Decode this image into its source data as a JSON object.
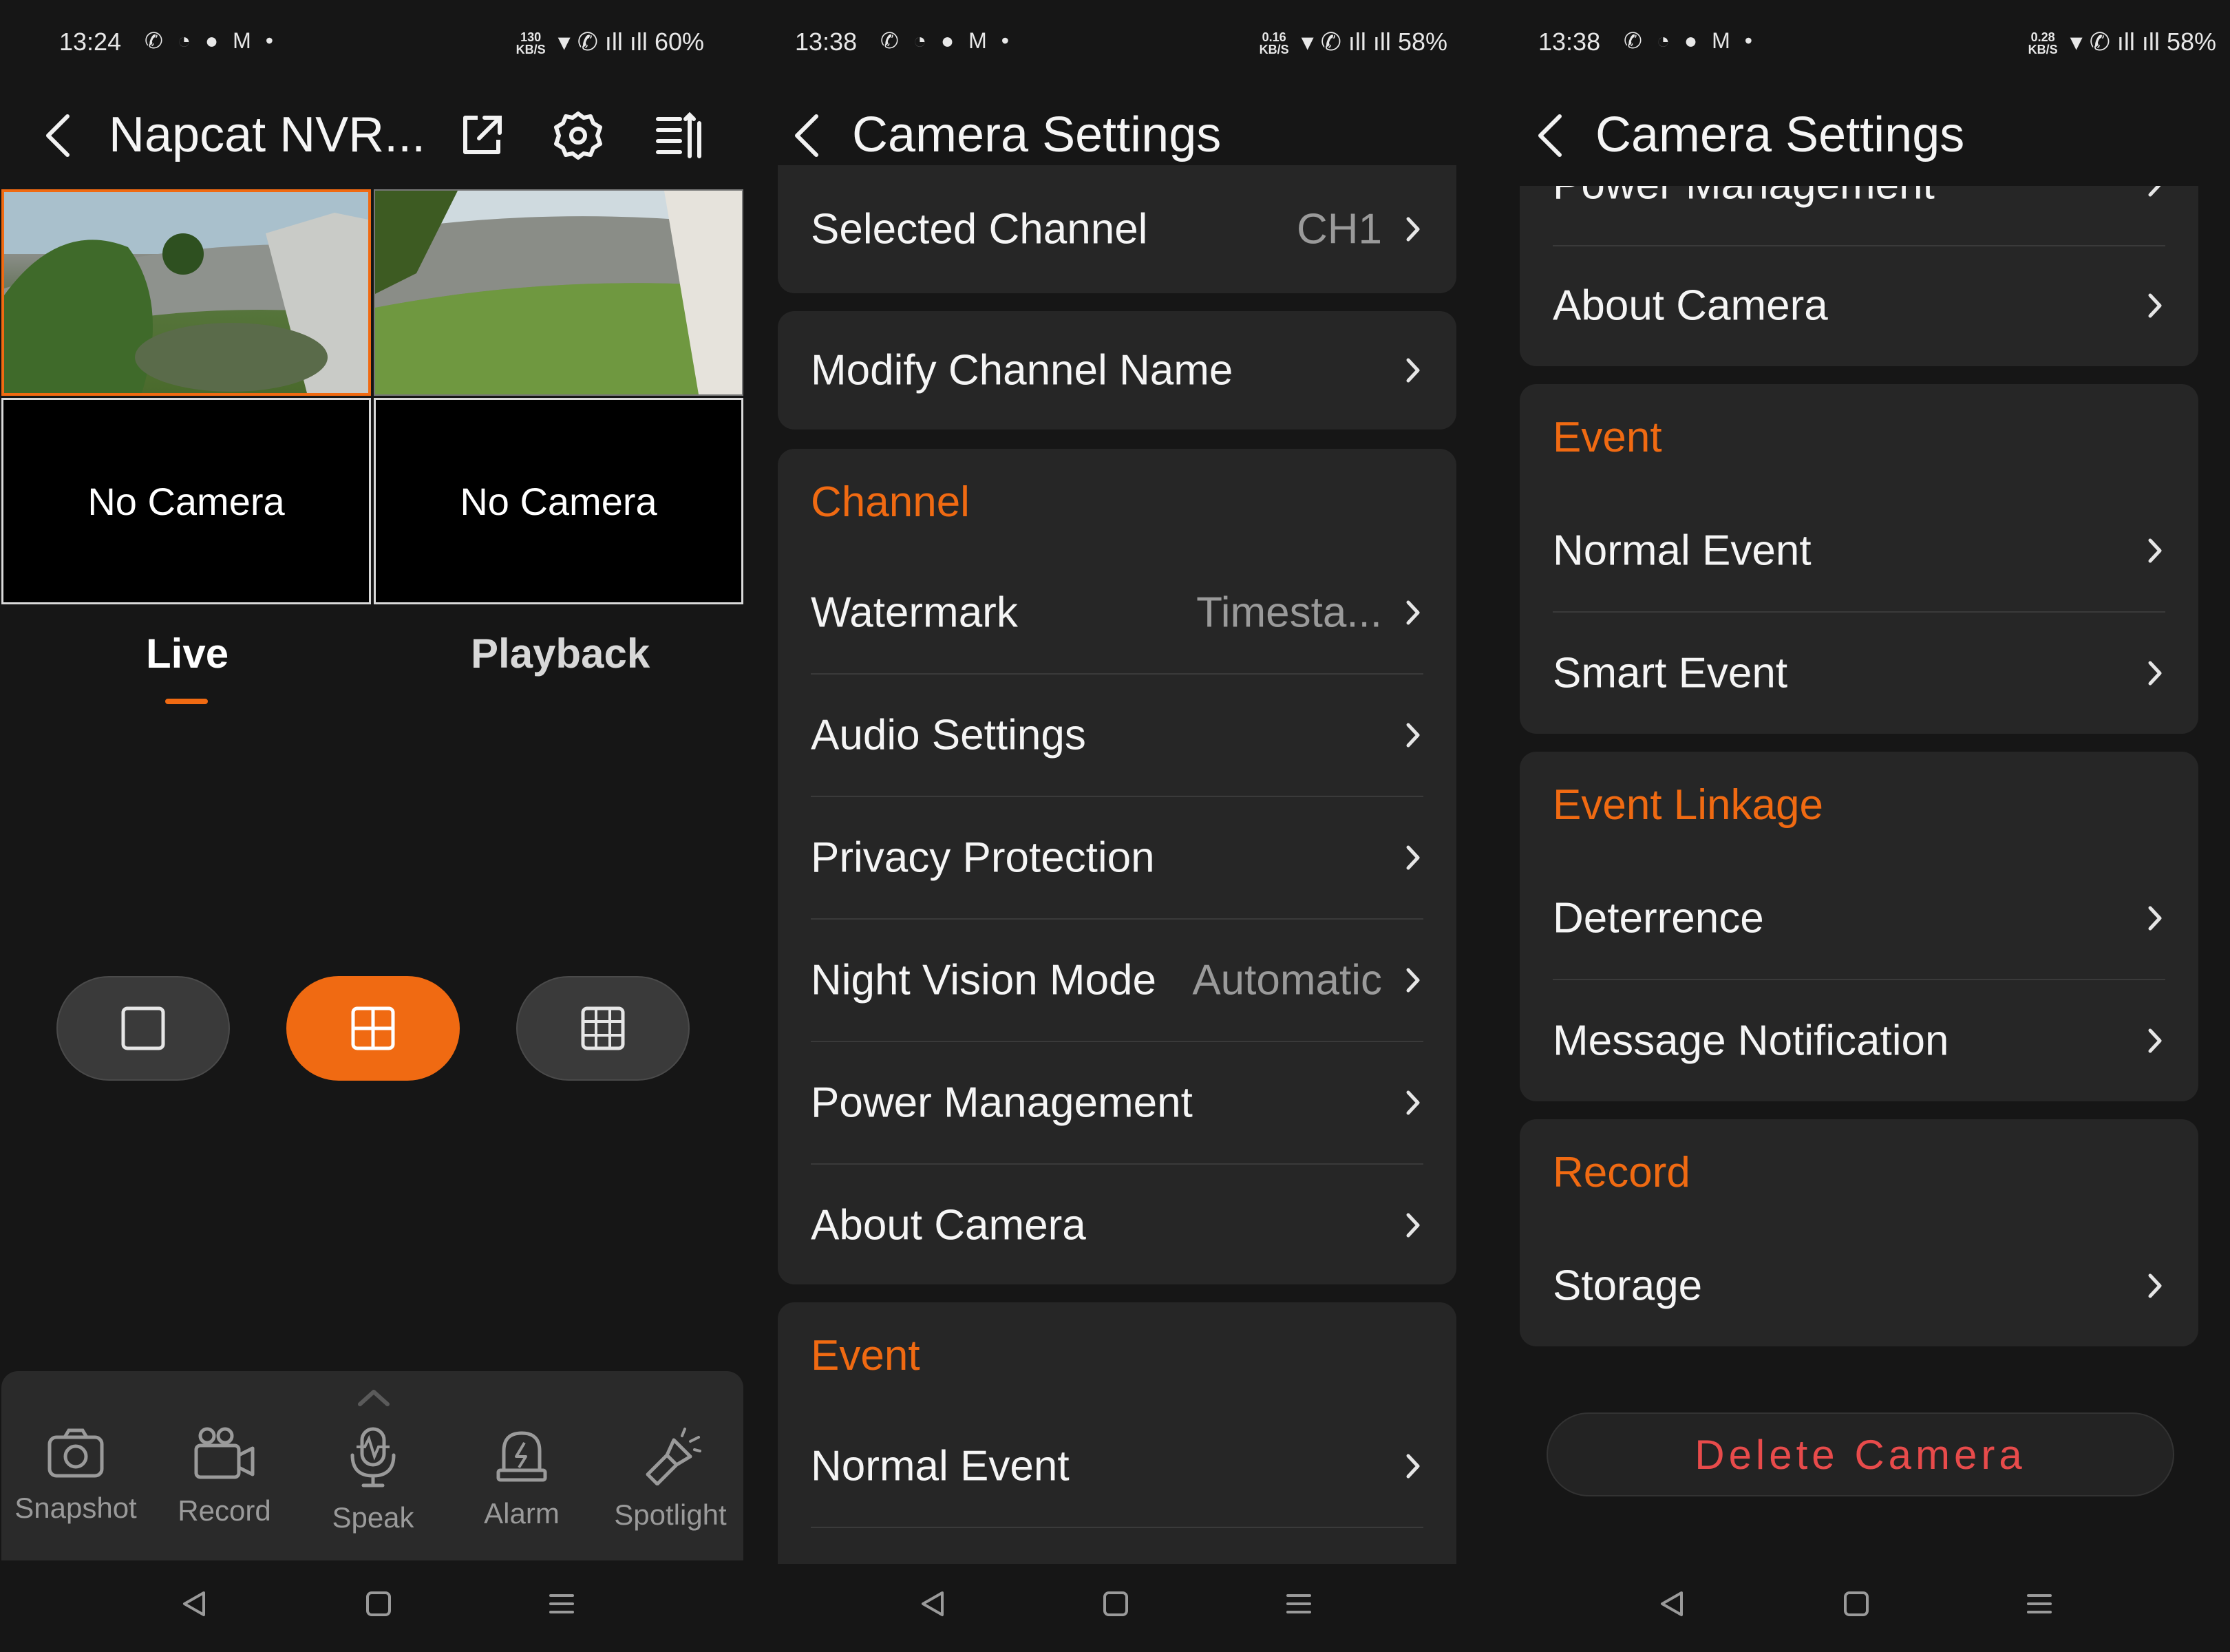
{
  "screens": [
    {
      "status": {
        "time": "13:24",
        "apps": "✆ ◔ ● M •",
        "speed_top": "130",
        "speed_unit": "KB/S",
        "signal": "▾ ✆ ıll ıll",
        "battery": "60%"
      },
      "header": {
        "title": "Napcat NVR..."
      },
      "grid": {
        "empty_label_1": "No Camera",
        "empty_label_2": "No Camera"
      },
      "tabs": {
        "live": "Live",
        "playback": "Playback"
      },
      "tools": [
        "Snapshot",
        "Record",
        "Speak",
        "Alarm",
        "Spotlight"
      ],
      "accent": "#F06A12"
    },
    {
      "status": {
        "time": "13:38",
        "apps": "✆ ◔ ● M •",
        "speed_top": "0.16",
        "speed_unit": "KB/S",
        "signal": "▾ ✆ ıll ıll",
        "battery": "58%"
      },
      "header": {
        "title": "Camera Settings"
      },
      "selected_channel": {
        "label": "Selected Channel",
        "value": "CH1"
      },
      "modify_channel": "Modify Channel Name",
      "channel_section": {
        "title": "Channel",
        "rows": [
          {
            "label": "Watermark",
            "value": "Timesta..."
          },
          {
            "label": "Audio Settings",
            "value": ""
          },
          {
            "label": "Privacy Protection",
            "value": ""
          },
          {
            "label": "Night Vision Mode",
            "value": "Automatic"
          },
          {
            "label": "Power Management",
            "value": ""
          },
          {
            "label": "About Camera",
            "value": ""
          }
        ]
      },
      "event_section": {
        "title": "Event",
        "rows": [
          {
            "label": "Normal Event"
          }
        ]
      }
    },
    {
      "status": {
        "time": "13:38",
        "apps": "✆ ◔ ● M •",
        "speed_top": "0.28",
        "speed_unit": "KB/S",
        "signal": "▾ ✆ ıll ıll",
        "battery": "58%"
      },
      "header": {
        "title": "Camera Settings"
      },
      "cut_row": "Power Management",
      "about": "About Camera",
      "event_section": {
        "title": "Event",
        "rows": [
          "Normal Event",
          "Smart Event"
        ]
      },
      "linkage_section": {
        "title": "Event Linkage",
        "rows": [
          "Deterrence",
          "Message Notification"
        ]
      },
      "record_section": {
        "title": "Record",
        "rows": [
          "Storage"
        ]
      },
      "delete_button": "Delete Camera"
    }
  ]
}
